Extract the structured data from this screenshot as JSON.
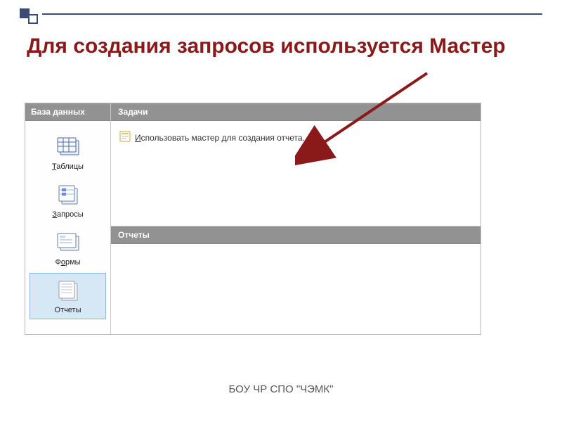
{
  "slide": {
    "title": "Для создания запросов используется Мастер",
    "footer": "БОУ ЧР СПО \"ЧЭМК\""
  },
  "sidebar": {
    "header": "База данных",
    "items": [
      {
        "label": "Таблицы",
        "accel": "Т",
        "icon": "tables-icon",
        "selected": false
      },
      {
        "label": "Запросы",
        "accel": "З",
        "icon": "queries-icon",
        "selected": false
      },
      {
        "label": "Формы",
        "accel": "о",
        "icon": "forms-icon",
        "selected": false
      },
      {
        "label": "Отчеты",
        "accel": "",
        "icon": "reports-icon",
        "selected": true
      }
    ]
  },
  "main": {
    "tasks_header": "Задачи",
    "task1": "Использовать мастер для создания отчета...",
    "reports_header": "Отчеты"
  },
  "colors": {
    "headline": "#8a1a1a",
    "panel_header": "#929292",
    "arrow": "#8a1a1a",
    "selected_bg": "#d6e7f5"
  }
}
